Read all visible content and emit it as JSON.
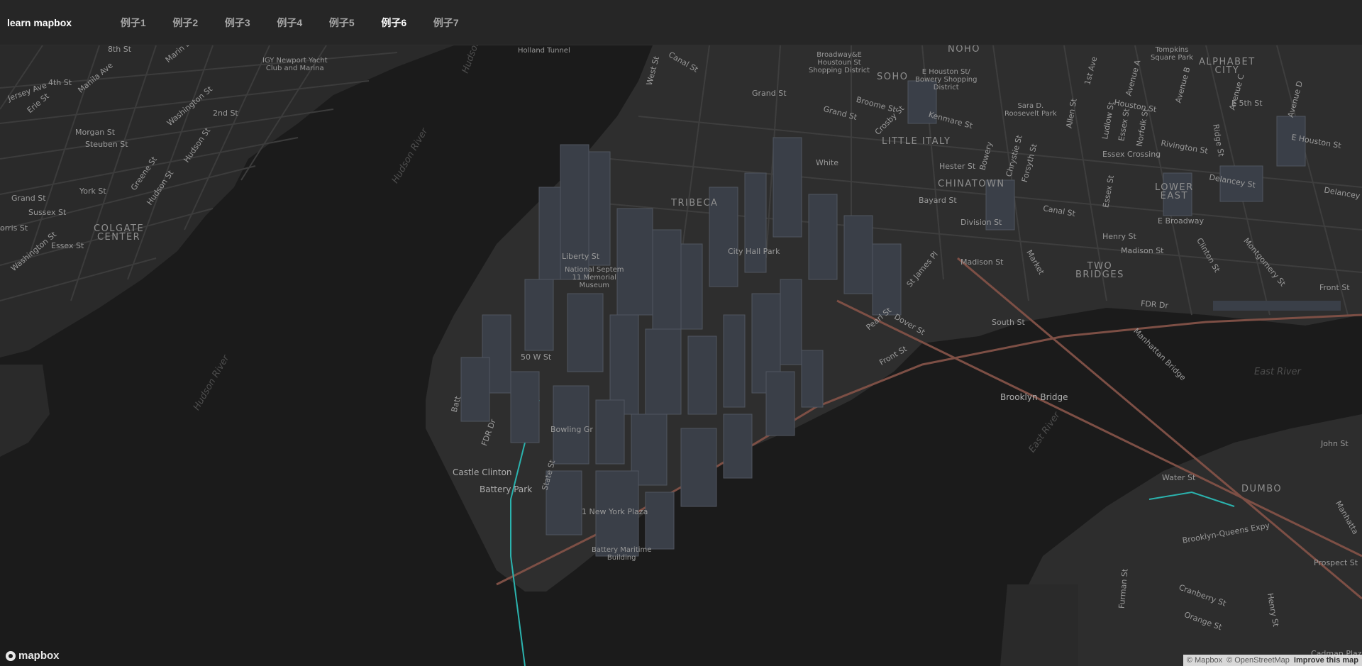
{
  "nav": {
    "brand": "learn mapbox",
    "items": [
      {
        "label": "例子1",
        "active": false
      },
      {
        "label": "例子2",
        "active": false
      },
      {
        "label": "例子3",
        "active": false
      },
      {
        "label": "例子4",
        "active": false
      },
      {
        "label": "例子5",
        "active": false
      },
      {
        "label": "例子6",
        "active": true
      },
      {
        "label": "例子7",
        "active": false
      }
    ]
  },
  "map": {
    "colors": {
      "water": "#1b1b1b",
      "land": "#2d2d2d",
      "road": "#3f3f3f",
      "highway": "#c97b6a",
      "rail": "#2bb3ae",
      "building": "#3a3f48"
    },
    "labels": {
      "holland_tunnel": "Holland Tunnel",
      "igy": "IGY Newport Yacht\nClub and Marina",
      "street_8th": "8th St",
      "marin": "Marin Bl",
      "jersey": "Jersey Ave",
      "street_4th": "4th St",
      "manila": "Manila Ave",
      "erie": "Erie St",
      "washington": "Washington St",
      "street_2nd": "2nd St",
      "morgan": "Morgan St",
      "steuben": "Steuben St",
      "hudson_st": "Hudson St",
      "hudson_st2": "Hudson St",
      "greene": "Greene St",
      "york": "York St",
      "grand_nj": "Grand St",
      "sussex": "Sussex St",
      "morris": "orris St",
      "colgate": "COLGATE\nCENTER",
      "essex_nj": "Essex St",
      "washington2": "Washington St",
      "hudson_river1": "Hudson River",
      "hudson_river2": "Hudson River",
      "hudson_top": "Hudson",
      "west_st": "West St",
      "canal": "Canal St",
      "soho": "SOHO",
      "noho": "NOHO",
      "broadway_houston": "Broadway&E\nHoustoun St\nShopping District",
      "e_houston": "E Houston St/\nBowery Shopping\nDistrict",
      "grand_st": "Grand St",
      "broome": "Broome St",
      "crosby": "Crosby St",
      "kenmare": "Kenmare St",
      "little_italy": "LITTLE ITALY",
      "white": "White",
      "hester": "Hester St",
      "chinatown": "CHINATOWN",
      "bayard": "Bayard St",
      "tribeca": "TRIBECA",
      "division": "Division St",
      "madison": "Madison St",
      "two_bridges": "TWO\nBRIDGES",
      "st_james": "St James Pl",
      "market": "Market",
      "city_hall": "City Hall Park",
      "memorial": "National Septem\n11 Memorial\nMuseum",
      "south_st": "South St",
      "pearl": "Pearl St",
      "dover": "Dover St",
      "front_st": "Front St",
      "brooklyn_bridge": "Brooklyn Bridge",
      "manhattan_bridge": "Manhattan Bridge",
      "east_river1": "East River",
      "east_river2": "East River",
      "fdr_dr": "FDR Dr",
      "fdr_dr2": "FDR Dr",
      "castle_clinton": "Castle Clinton",
      "battery_park": "Battery Park",
      "battery_maritime": "Battery Maritime\nBuilding",
      "ny_plaza": "1 New York Plaza",
      "water_st": "Water St",
      "dumbo": "DUMBO",
      "john_st": "John St",
      "bqe": "Brooklyn-Queens Expy",
      "prospect": "Prospect St",
      "furman": "Furman St",
      "cranberry": "Cranberry St",
      "orange": "Orange St",
      "henry_bk": "Henry St",
      "cadman": "Cadman Plaza",
      "manhattan_cut": "Manhatta",
      "tompkins": "Tompkins\nSquare Park",
      "alphabet": "ALPHABET\nCITY",
      "avenue_a": "Avenue A",
      "avenue_b": "Avenue B",
      "avenue_c": "Avenue C",
      "avenue_d": "Avenue D",
      "first_ave": "1st Ave",
      "e_5th": "E 5th St",
      "houston_st": "Houston St",
      "e_houston_st": "E Houston St",
      "sara_roosevelt": "Sara D.\nRoosevelt Park",
      "allen": "Allen St",
      "ludlow": "Ludlow St",
      "essex_st": "Essex St",
      "norfolk": "Norfolk St",
      "ridge": "Ridge St",
      "rivington": "Rivington St",
      "essex_crossing": "Essex Crossing",
      "delancey": "Delancey St",
      "delancey2": "Delancey St",
      "lower_east": "LOWER\nEAST",
      "e_broadway": "E Broadway",
      "henry_st": "Henry St",
      "madison_st2": "Madison St",
      "clinton": "Clinton St",
      "montgomery": "Montgomery St",
      "front_st2": "Front St",
      "chrystie": "Chrystie St",
      "forsyth": "Forsyth St",
      "bowery": "Bowery",
      "canal2": "Canal St",
      "grand_st2": "Grand St",
      "essex_st2": "Essex St",
      "w_50": "50 W St",
      "battery_pl": "Batt",
      "bowling": "Bowling Gr",
      "state": "State St",
      "liberty": "Liberty St"
    },
    "logo": "mapbox",
    "attribution": {
      "mapbox": "© Mapbox",
      "osm": "© OpenStreetMap",
      "improve": "Improve this map"
    }
  }
}
